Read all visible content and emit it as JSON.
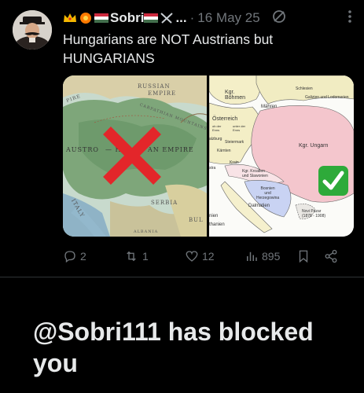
{
  "tweet": {
    "author": {
      "name": "Sobri",
      "emojis": [
        "crown-emoji",
        "flower-emoji",
        "hungary-flag-emoji",
        "hungary-flag-emoji",
        "crossed-swords-emoji"
      ],
      "ellipsis": "..."
    },
    "separator": "·",
    "date": "16 May 25",
    "text": "Hungarians are NOT Austrians but HUNGARIANS",
    "media": {
      "left_map": {
        "labels": {
          "russian": "RUSSIAN",
          "empire_top": "EMPIRE",
          "austro": "AUSTRO",
          "h": "— H",
          "empire": "AN EMPIRE",
          "serbia": "SERBIA",
          "carpathian": "CARPATHIAN MOUNTAINS",
          "italy": "ITALY",
          "bul": "BUL",
          "albania": "ALBANIA",
          "ire": "PIRE"
        },
        "mark": "red-x"
      },
      "right_map": {
        "labels": {
          "bohmen": "Kgr.\nBöhmen",
          "mahren": "Mähren",
          "schlesien": "Schlesien",
          "galizien": "Galizien und Lodomerien",
          "osterreich": "Österreich",
          "ob_der_enns": "ob der\nEnns",
          "unter_der_enns": "unter der\nEnns",
          "salzburg": "alzburg",
          "steiermark": "Steiermark",
          "karnten": "Kärnten",
          "krain": "Krain",
          "ungarn": "Kgr. Ungarn",
          "kroatien": "Kgr. Kroatien\nund Slawonien",
          "bosnien": "Bosnien\nund\nHerzegowina",
          "dalmatien": "Dalmatien",
          "nien": "nien",
          "thanien": "thanien",
          "novi_pazar": "Novi Pazar\n(1878 - 1908)",
          "stra": "stra"
        },
        "mark": "green-check"
      }
    },
    "actions": {
      "replies": "2",
      "reposts": "1",
      "likes": "12",
      "views": "895"
    }
  },
  "blocked_message": "@Sobri111 has blocked you",
  "colors": {
    "background": "#000000",
    "text": "#e7e9ea",
    "muted": "#71767b",
    "red_x": "#e3262a",
    "green_check": "#2eaa3a"
  }
}
